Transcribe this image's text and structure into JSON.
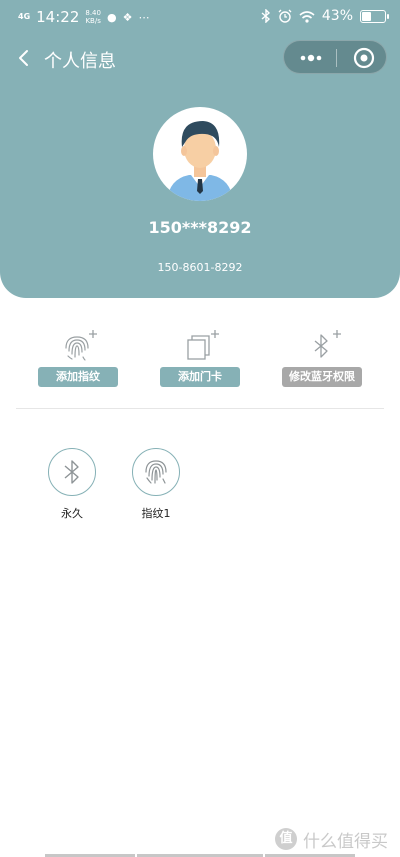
{
  "status_bar": {
    "network": "4G",
    "time": "14:22",
    "speed_value": "8.40",
    "speed_unit": "KB/s",
    "battery": "43%",
    "battery_level": 0.43
  },
  "nav": {
    "title": "个人信息",
    "back_icon": "chevron-left-icon",
    "more_icon": "more-dots-icon",
    "close_icon": "target-circle-icon"
  },
  "profile": {
    "masked_phone": "150***8292",
    "full_phone": "150-8601-8292"
  },
  "actions": [
    {
      "label": "添加指纹",
      "icon": "fingerprint-plus-icon",
      "style": "teal"
    },
    {
      "label": "添加门卡",
      "icon": "card-plus-icon",
      "style": "teal"
    },
    {
      "label": "修改蓝牙权限",
      "icon": "bluetooth-plus-icon",
      "style": "gray"
    }
  ],
  "keys": [
    {
      "label": "永久",
      "icon": "bluetooth-icon"
    },
    {
      "label": "指纹1",
      "icon": "fingerprint-icon"
    }
  ],
  "watermark": {
    "logo": "值",
    "text": "什么值得买"
  },
  "colors": {
    "accent": "#86b1b6",
    "disabled": "#a8a8a8"
  }
}
